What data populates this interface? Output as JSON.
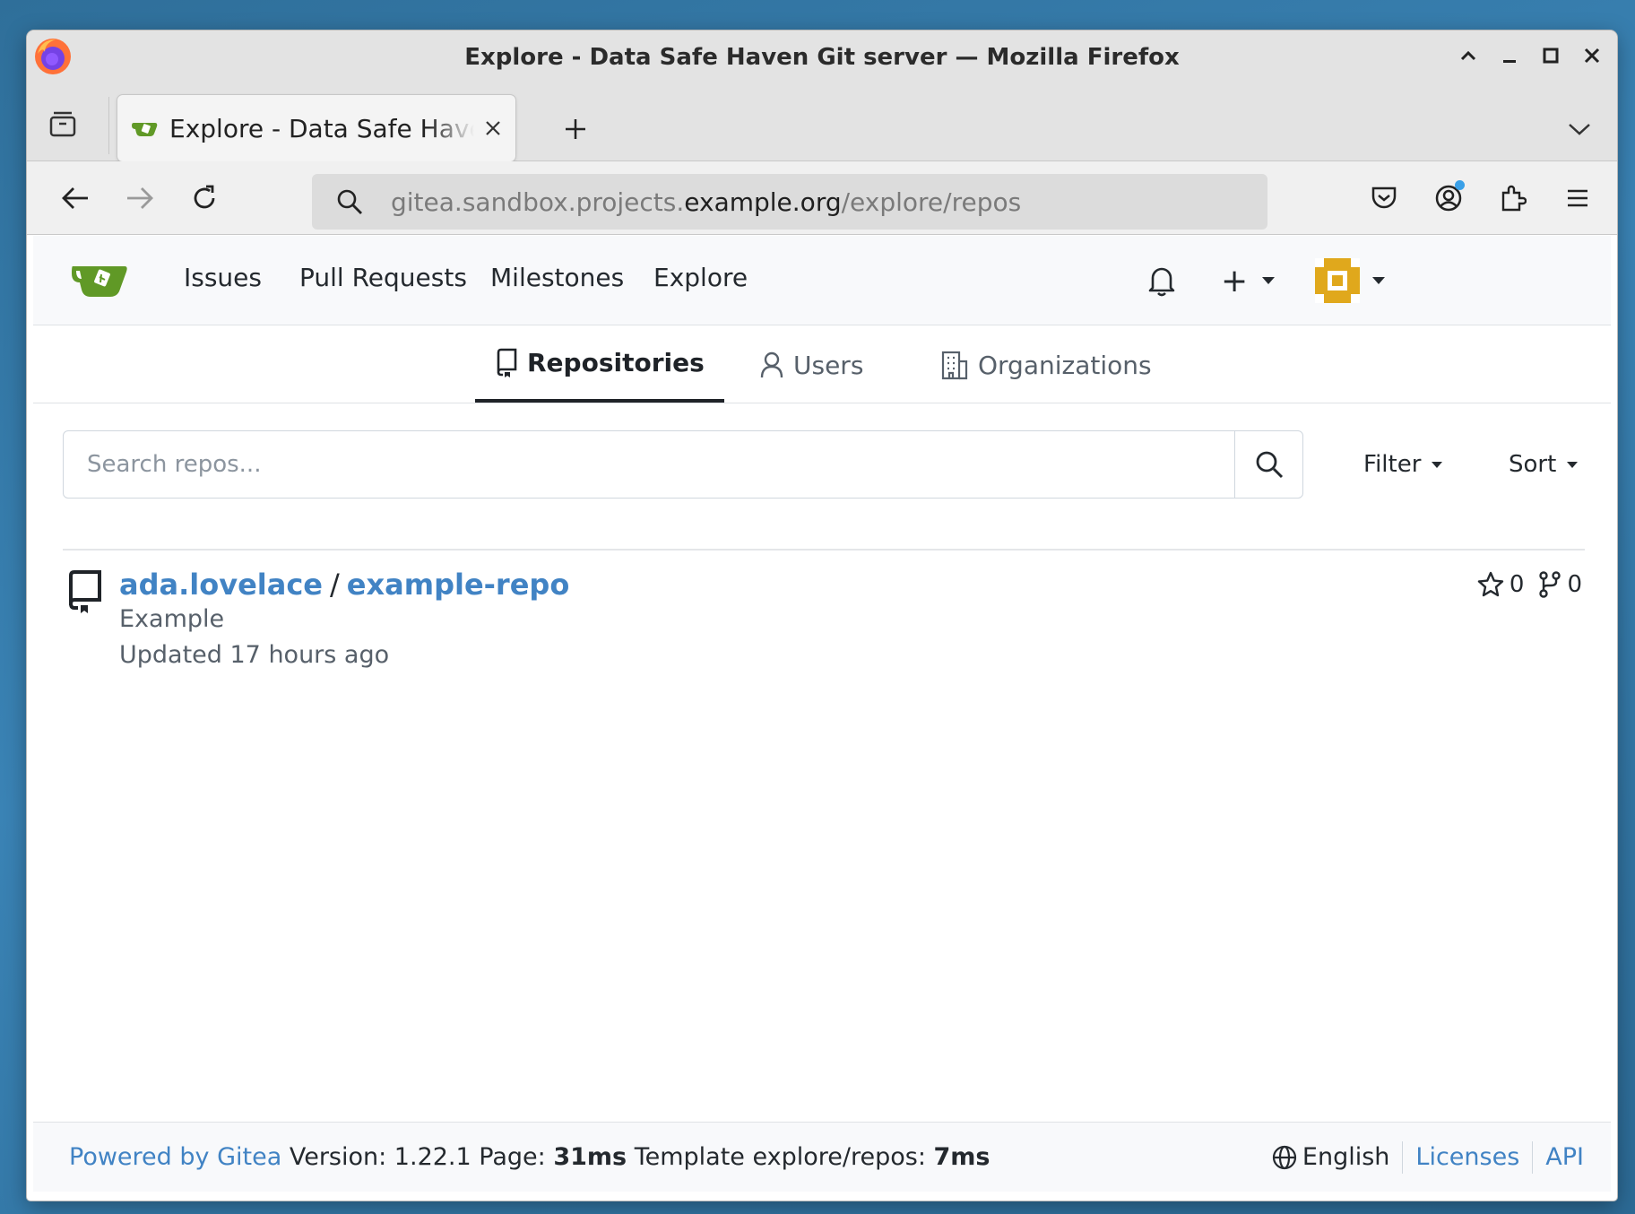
{
  "window": {
    "title": "Explore - Data Safe Haven Git server — Mozilla Firefox"
  },
  "tabs": [
    {
      "title": "Explore - Data Safe Haven Git server"
    }
  ],
  "urlbar": {
    "url_prefix": "gitea.sandbox.projects.",
    "url_domain": "example.org",
    "url_path": "/explore/repos"
  },
  "gitea_nav": {
    "items": [
      "Issues",
      "Pull Requests",
      "Milestones",
      "Explore"
    ],
    "create_label": "+"
  },
  "explore_tabs": {
    "repositories": "Repositories",
    "users": "Users",
    "organizations": "Organizations",
    "active": "repositories"
  },
  "search": {
    "placeholder": "Search repos...",
    "value": "",
    "filter_label": "Filter",
    "sort_label": "Sort"
  },
  "repos": [
    {
      "owner": "ada.lovelace",
      "separator": "/",
      "name": "example-repo",
      "description": "Example",
      "updated": "Updated 17 hours ago",
      "stars": "0",
      "forks": "0"
    }
  ],
  "footer": {
    "powered_by": "Powered by Gitea",
    "version_text": "Version: 1.22.1 Page:",
    "page_time": "31ms",
    "template_text": "Template explore/repos:",
    "template_time": "7ms",
    "language": "English",
    "licenses": "Licenses",
    "api": "API"
  },
  "colors": {
    "link": "#4183c4",
    "gitea_green": "#609926",
    "avatar": "#e0a81c"
  }
}
